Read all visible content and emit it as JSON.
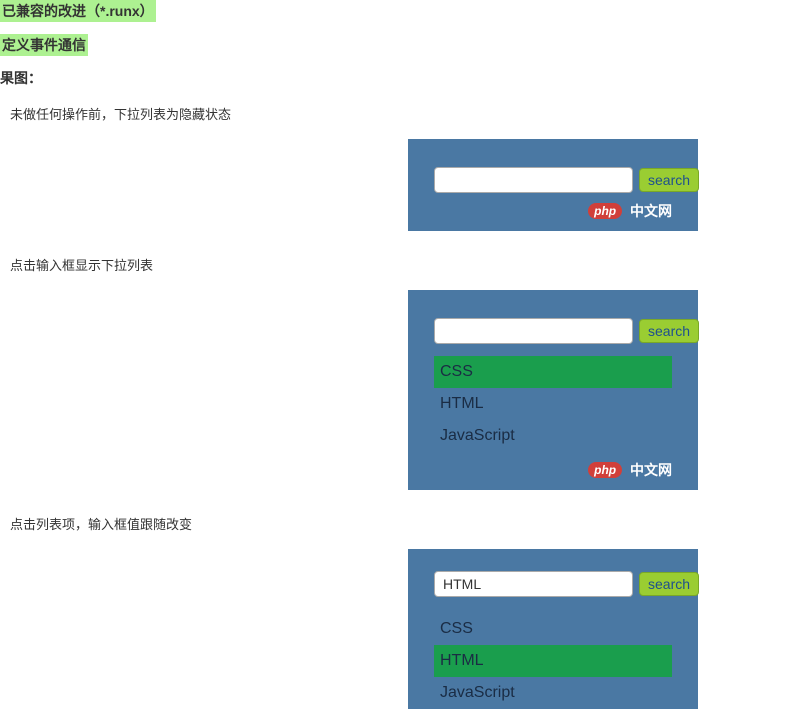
{
  "header": {
    "line1": "已兼容的改进（*.runx）",
    "line2": "定义事件通信",
    "line3": "果图："
  },
  "steps": {
    "step1": "未做任何操作前，下拉列表为隐藏状态",
    "step2": "点击输入框显示下拉列表",
    "step3": "点击列表项，输入框值跟随改变"
  },
  "search": {
    "button_label": "search",
    "input1_value": "",
    "input2_value": "",
    "input3_value": "HTML"
  },
  "dropdown": {
    "items": [
      {
        "label": "CSS"
      },
      {
        "label": "HTML"
      },
      {
        "label": "JavaScript"
      }
    ]
  },
  "watermark": {
    "badge": "php",
    "text": "中文网"
  }
}
